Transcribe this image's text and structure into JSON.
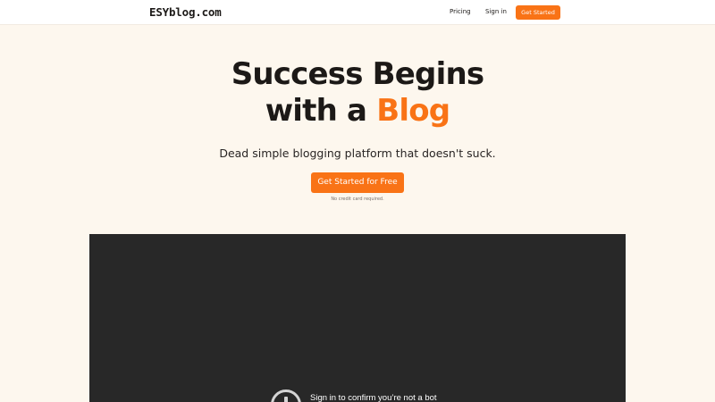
{
  "header": {
    "logo": "ESYblog.com",
    "nav": {
      "pricing": "Pricing",
      "signin": "Sign in",
      "cta": "Get Started"
    }
  },
  "hero": {
    "title_line1": "Success Begins",
    "title_line2_prefix": "with a ",
    "title_line2_accent": "Blog",
    "subtitle": "Dead simple blogging platform that doesn't suck.",
    "cta": "Get Started for Free",
    "note": "No credit card required."
  },
  "embed": {
    "message": "Sign in to confirm you’re not a bot",
    "icon": "alert-circle-icon"
  },
  "colors": {
    "accent": "#f97316",
    "background": "#fdf7ee",
    "embed_bg": "#282828"
  }
}
